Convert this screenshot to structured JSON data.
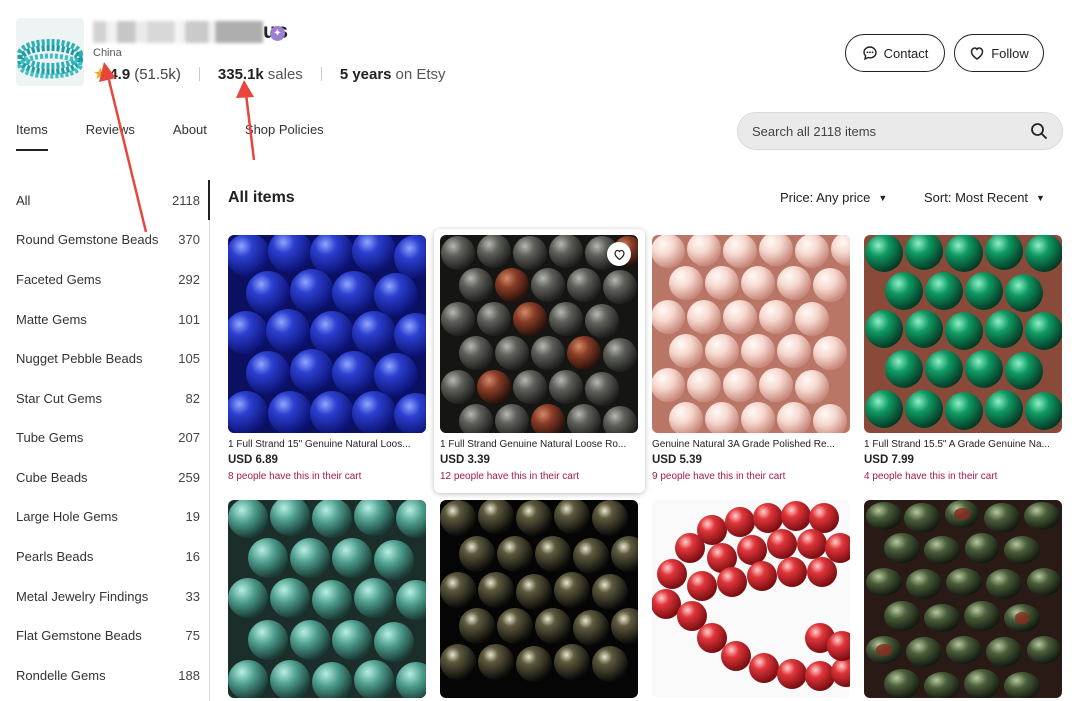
{
  "shop": {
    "name_tail": "us",
    "location": "China",
    "rating": "4.9",
    "review_count": "(51.5k)",
    "sales": "335.1k",
    "sales_label": "sales",
    "years": "5 years",
    "years_label": "on Etsy"
  },
  "header_buttons": {
    "contact": "Contact",
    "follow": "Follow"
  },
  "tabs": [
    {
      "label": "Items",
      "active": true
    },
    {
      "label": "Reviews",
      "active": false
    },
    {
      "label": "About",
      "active": false
    },
    {
      "label": "Shop Policies",
      "active": false
    }
  ],
  "search": {
    "placeholder": "Search all 2118 items"
  },
  "sidebar": {
    "items": [
      {
        "label": "All",
        "count": "2118"
      },
      {
        "label": "Round Gemstone Beads",
        "count": "370"
      },
      {
        "label": "Faceted Gems",
        "count": "292"
      },
      {
        "label": "Matte Gems",
        "count": "101"
      },
      {
        "label": "Nugget Pebble Beads",
        "count": "105"
      },
      {
        "label": "Star Cut Gems",
        "count": "82"
      },
      {
        "label": "Tube Gems",
        "count": "207"
      },
      {
        "label": "Cube Beads",
        "count": "259"
      },
      {
        "label": "Large Hole Gems",
        "count": "19"
      },
      {
        "label": "Pearls Beads",
        "count": "16"
      },
      {
        "label": "Metal Jewelry Findings",
        "count": "33"
      },
      {
        "label": "Flat Gemstone Beads",
        "count": "75"
      },
      {
        "label": "Rondelle Gems",
        "count": "188"
      }
    ]
  },
  "main": {
    "title": "All items",
    "price_filter": "Price: Any price",
    "sort_filter": "Sort: Most Recent"
  },
  "products": [
    {
      "title": "1 Full Strand 15\" Genuine Natural Loos...",
      "price": "USD 6.89",
      "cart": "8 people have this in their cart"
    },
    {
      "title": "1 Full Strand Genuine Natural Loose Ro...",
      "price": "USD 3.39",
      "cart": "12 people have this in their cart"
    },
    {
      "title": "Genuine Natural 3A Grade Polished Re...",
      "price": "USD 5.39",
      "cart": "9 people have this in their cart"
    },
    {
      "title": "1 Full Strand 15.5\" A Grade Genuine Na...",
      "price": "USD 7.99",
      "cart": "4 people have this in their cart"
    }
  ],
  "colors": {
    "accent": "#222222",
    "cart_text": "#a61a4a",
    "star": "#f5a623",
    "annotation_arrow": "#e8453c"
  }
}
